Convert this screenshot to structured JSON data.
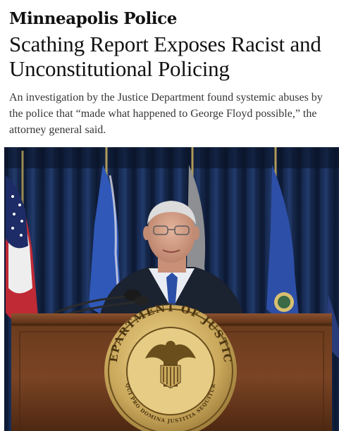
{
  "article": {
    "kicker": "Minneapolis Police",
    "headline": "Scathing Report Exposes Racist and Unconstitutional Policing",
    "summary": "An investigation by the Justice Department found systemic abuses by the police that “made what happened to George Floyd possible,” the attorney general said."
  },
  "photo": {
    "seal_top_text": "DEPARTMENT OF JUSTICE",
    "seal_motto": "QUI PRO DOMINA JUSTITIA SEQUITUR"
  }
}
